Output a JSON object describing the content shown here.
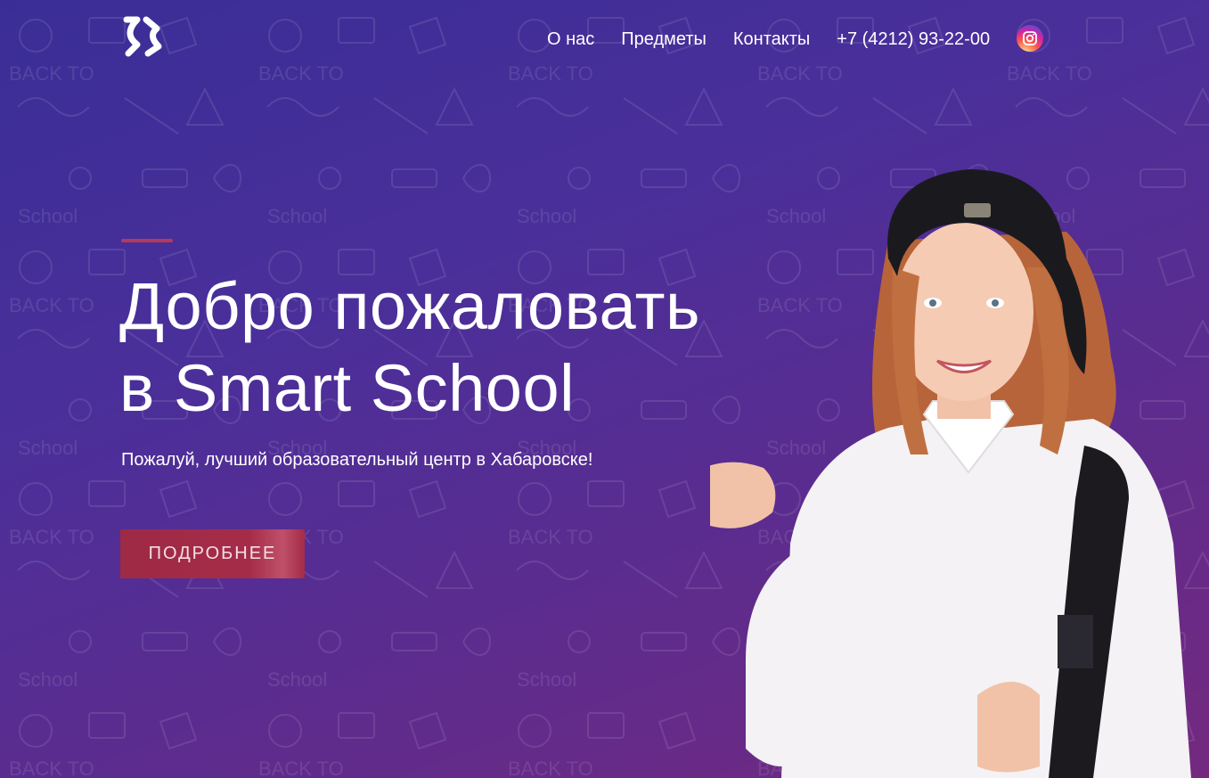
{
  "header": {
    "logo": "SS-logo",
    "nav": [
      "О нас",
      "Предметы",
      "Контакты"
    ],
    "phone": "+7 (4212) 93-22-00",
    "social_icon": "instagram-icon"
  },
  "hero": {
    "title_line1": "Добро пожаловать",
    "title_line2": "в Smart School",
    "subtitle": "Пожалуй, лучший образовательный центр в Хабаровске!",
    "button_label": "ПОДРОБНЕЕ"
  },
  "colors": {
    "bg_start": "#3a2e96",
    "bg_end": "#74297f",
    "accent": "#b43a5a",
    "button": "#a52c48"
  },
  "image": "girl-with-cap-and-backpack-pointing"
}
